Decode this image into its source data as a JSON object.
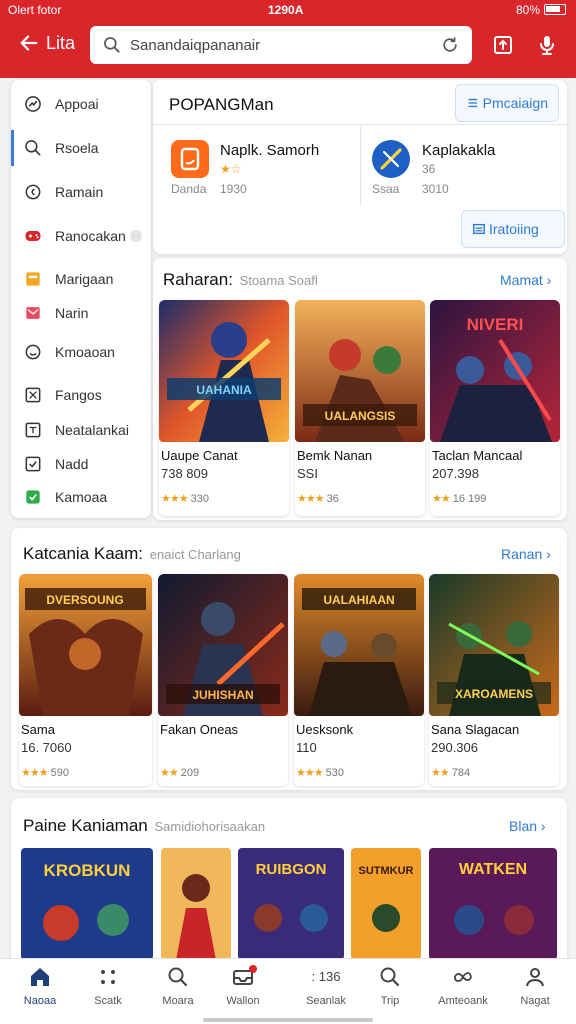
{
  "status": {
    "carrier": "Olert fotor",
    "time": "1290A",
    "battery": "80%"
  },
  "appbar": {
    "back_label": "Lita",
    "search_value": "Sanandaiqpananair"
  },
  "sidebar": {
    "items": [
      {
        "label": "Appoai",
        "icon": "gauge-icon"
      },
      {
        "label": "Rsoela",
        "icon": "search-icon"
      },
      {
        "label": "Ramain",
        "icon": "circle-icon"
      },
      {
        "label": "Ranocakan",
        "icon": "gamepad-icon"
      },
      {
        "label": "Marigaan",
        "icon": "box-icon"
      },
      {
        "label": "Narin",
        "icon": "envelope-icon"
      },
      {
        "label": "Kmoaoan",
        "icon": "smile-icon"
      },
      {
        "label": "Fangos",
        "icon": "cross-box-icon"
      },
      {
        "label": "Neatalankai",
        "icon": "frame-icon"
      },
      {
        "label": "Nadd",
        "icon": "check-box-icon"
      },
      {
        "label": "Kamoaa",
        "icon": "check-green-icon"
      }
    ]
  },
  "panel": {
    "title": "POPANGMan",
    "pill_top": "Pmcaiaign",
    "pill_mid": "Iratoiing",
    "apps": [
      {
        "name": "Naplk. Samorh",
        "sub1": "Danda",
        "sub2": "1930",
        "stars": "★☆"
      },
      {
        "name": "Kaplakakla",
        "sub1": "Ssaa",
        "sub2": "3010",
        "stars": "36"
      }
    ]
  },
  "section1": {
    "title": "Raharan:",
    "subtitle": "Stoama Soafl",
    "link": "Mamat ›",
    "cards": [
      {
        "name": "Uaupe Canat",
        "value": "738 809",
        "rating": "330"
      },
      {
        "name": "Bemk Nanan",
        "value": "SSI",
        "rating": "36"
      },
      {
        "name": "Taclan Mancaal",
        "value": "207.398",
        "rating": "16 199"
      }
    ]
  },
  "section2": {
    "title": "Katcania Kaam:",
    "subtitle": "enaict Charlang",
    "link": "Ranan ›",
    "cards": [
      {
        "name": "Sama",
        "value": "16. 7060",
        "rating": "590"
      },
      {
        "name": "Fakan Oneas",
        "value": "",
        "rating": "209"
      },
      {
        "name": "Uesksonk",
        "value": "110",
        "rating": "530"
      },
      {
        "name": "Sana Slagacan",
        "value": "290.306",
        "rating": "784"
      }
    ]
  },
  "section3": {
    "title": "Paine Kaniaman",
    "subtitle": "Samidiohorisaakan",
    "link": "Blan ›",
    "thumb_labels": [
      "KROBKUN",
      "",
      "RUIBGON",
      "SUTMKUR",
      "WATKEN"
    ]
  },
  "card_texts": {
    "s1": [
      "UAHANIA",
      "UALANGSIS",
      "NIVERI"
    ],
    "s2": [
      "DVERSOUNG",
      "JUHISHAN",
      "UALAHIAAN",
      "XAROAMENS"
    ]
  },
  "bottomnav": {
    "items": [
      {
        "label": "Naoaa",
        "icon": "home-icon"
      },
      {
        "label": "Scatk",
        "icon": "grid-dots-icon"
      },
      {
        "label": "Moara",
        "icon": "search-icon"
      },
      {
        "label": "Wallon",
        "icon": "inbox-icon"
      },
      {
        "label": "Seanlak",
        "icon": "code-icon"
      },
      {
        "label": "Trip",
        "icon": "search-icon"
      },
      {
        "label": "Amteoank",
        "icon": "infinity-icon"
      },
      {
        "label": "Nagat",
        "icon": "user-icon"
      }
    ],
    "scrap_text": ": 136"
  },
  "colors": {
    "brand_red": "#d9262b",
    "link_blue": "#2f7bd0",
    "star": "#f0a020"
  }
}
